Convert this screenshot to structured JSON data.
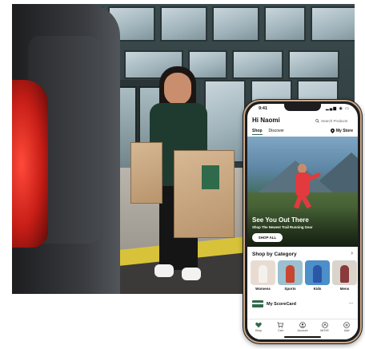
{
  "status_bar": {
    "time": "9:41",
    "icons": "▂▄▆ ◉ ▭"
  },
  "header": {
    "greeting": "Hi Naomi",
    "search_placeholder": "Search Products"
  },
  "tabs": [
    {
      "label": "Shop",
      "active": true
    },
    {
      "label": "Discover",
      "active": false
    }
  ],
  "store": {
    "label": "My Store"
  },
  "hero": {
    "title": "See You Out There",
    "subtitle": "Shop The Newest Trail Running Gear",
    "button_label": "SHOP ALL"
  },
  "categories": {
    "heading": "Shop by Category",
    "chevron": "›",
    "items": [
      {
        "label": "Womens",
        "color": "#e8dcd2",
        "figure": "#f4f1ec"
      },
      {
        "label": "Sports",
        "color": "#9cc0cf",
        "figure": "#c8452f"
      },
      {
        "label": "Kids",
        "color": "#4d8fc9",
        "figure": "#2a57a8"
      },
      {
        "label": "Mens",
        "color": "#d9d4cc",
        "figure": "#8a3a3a"
      }
    ]
  },
  "scorecard": {
    "label": "My ScoreCard",
    "more": "..."
  },
  "bottom_nav": [
    {
      "label": "Shop",
      "icon": "heart-icon"
    },
    {
      "label": "Cart",
      "icon": "cart-icon"
    },
    {
      "label": "Account",
      "icon": "account-icon"
    },
    {
      "label": "MOVE",
      "icon": "move-icon"
    },
    {
      "label": "Add",
      "icon": "plus-icon"
    }
  ],
  "colors": {
    "brand_green": "#2f6a4a",
    "accent_red": "#e23a3f"
  }
}
